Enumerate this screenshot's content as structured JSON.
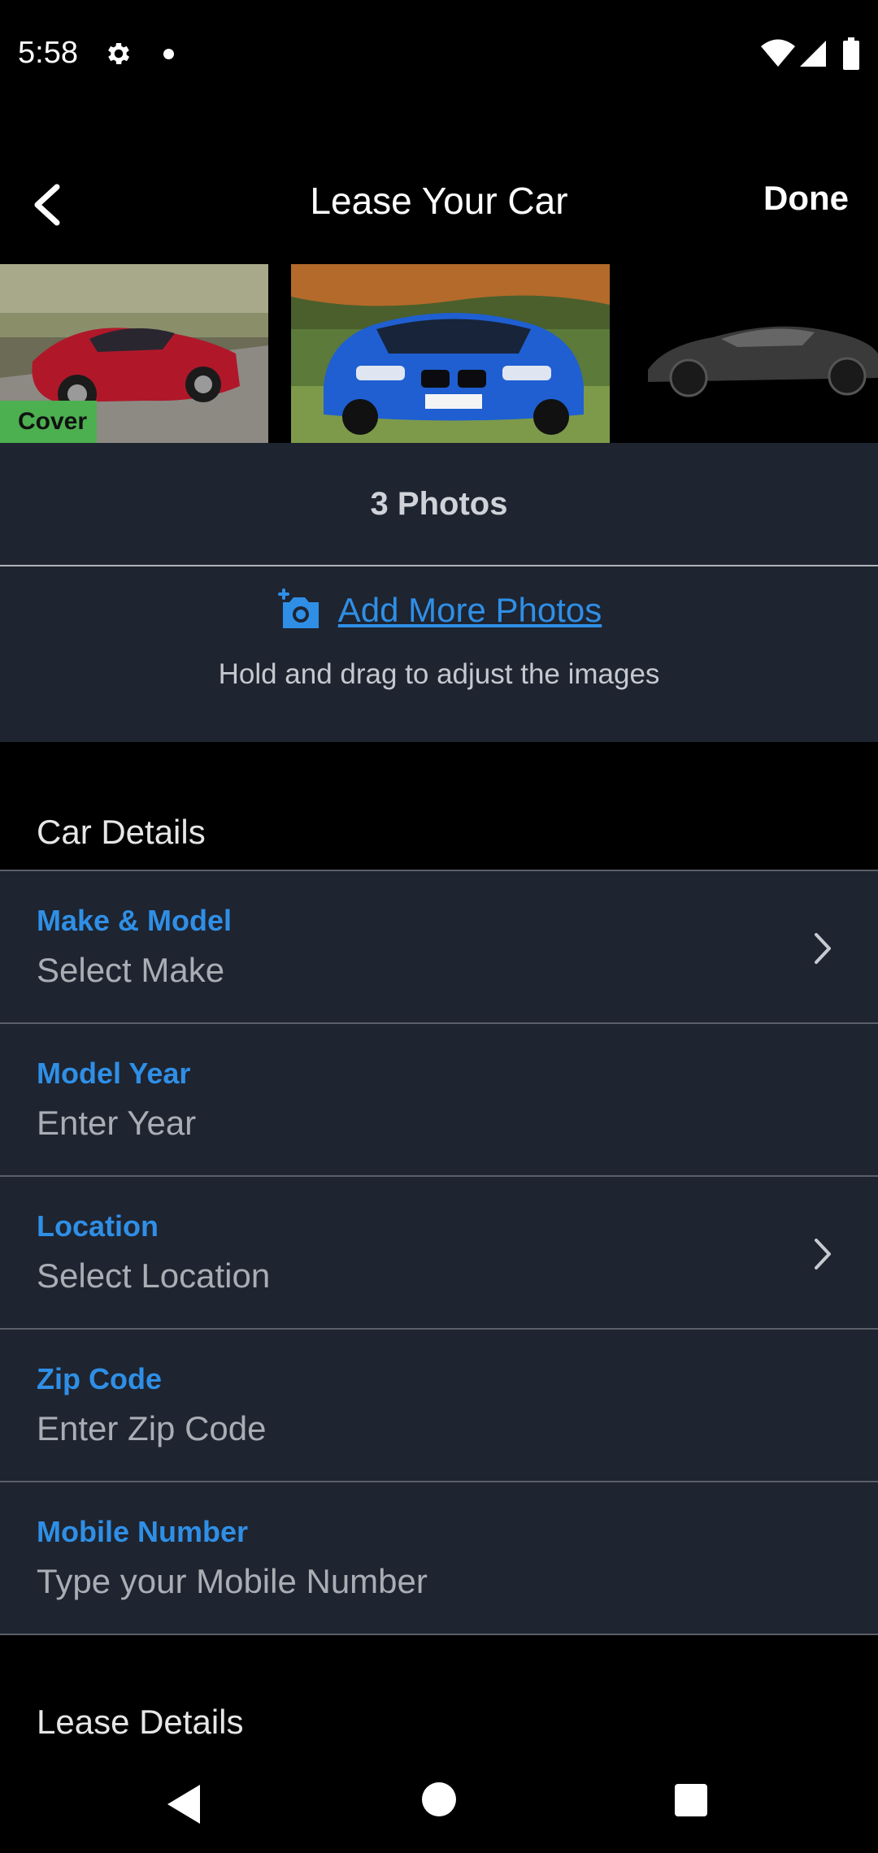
{
  "status_bar": {
    "time": "5:58"
  },
  "app_bar": {
    "title": "Lease Your Car",
    "done_label": "Done"
  },
  "photos": {
    "cover_label": "Cover",
    "count_label": "3 Photos",
    "add_more_label": "Add More Photos",
    "hint": "Hold and drag to adjust the images"
  },
  "sections": {
    "car_details": "Car Details",
    "lease_details": "Lease Details"
  },
  "form": {
    "make_model": {
      "label": "Make & Model",
      "value": "Select Make"
    },
    "model_year": {
      "label": "Model Year",
      "value": "Enter Year"
    },
    "location": {
      "label": "Location",
      "value": "Select Location"
    },
    "zip_code": {
      "label": "Zip Code",
      "value": "Enter Zip Code"
    },
    "mobile_number": {
      "label": "Mobile Number",
      "value": "Type your Mobile Number"
    }
  },
  "colors": {
    "accent_blue": "#2f8fe6",
    "cover_green": "#4caf50",
    "panel_bg": "#1e2430"
  }
}
